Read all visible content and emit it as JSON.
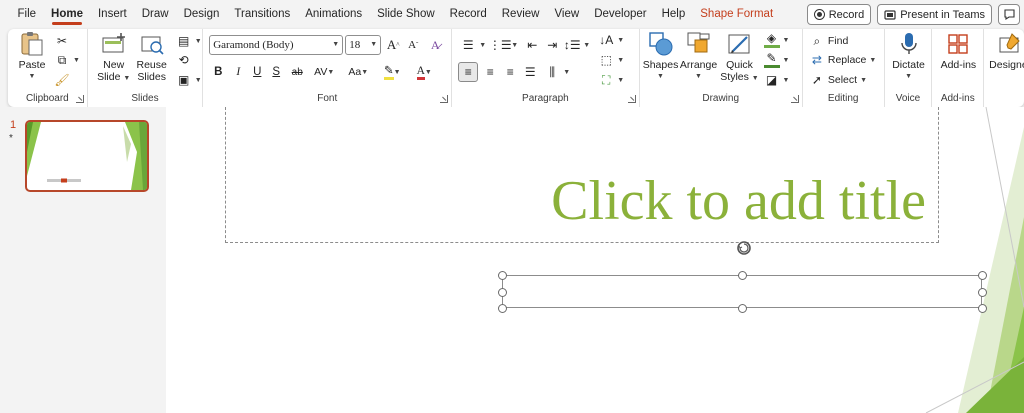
{
  "menu": {
    "tabs": [
      "File",
      "Home",
      "Insert",
      "Draw",
      "Design",
      "Transitions",
      "Animations",
      "Slide Show",
      "Record",
      "Review",
      "View",
      "Developer",
      "Help",
      "Shape Format"
    ],
    "record_label": "Record",
    "present_label": "Present in Teams"
  },
  "ribbon": {
    "clipboard": {
      "label": "Clipboard",
      "paste": "Paste"
    },
    "slides": {
      "label": "Slides",
      "new_slide_1": "New",
      "new_slide_2": "Slide",
      "reuse_1": "Reuse",
      "reuse_2": "Slides"
    },
    "font": {
      "label": "Font",
      "family": "Garamond (Body)",
      "size": "18"
    },
    "paragraph": {
      "label": "Paragraph"
    },
    "drawing": {
      "label": "Drawing",
      "shapes": "Shapes",
      "arrange": "Arrange",
      "quick_1": "Quick",
      "quick_2": "Styles"
    },
    "editing": {
      "label": "Editing",
      "find": "Find",
      "replace": "Replace",
      "select": "Select"
    },
    "voice": {
      "label": "Voice",
      "dictate": "Dictate"
    },
    "addins": {
      "label": "Add-ins",
      "addins": "Add-ins"
    },
    "designer": {
      "label": "Designer"
    }
  },
  "thumbs": {
    "slide_number": "1",
    "marker": "*"
  },
  "slide": {
    "title_placeholder": "Click to add title"
  },
  "colors": {
    "accent": "#c43e1c",
    "title_green": "#8bb13a",
    "slide_green": "#8bc34a"
  }
}
